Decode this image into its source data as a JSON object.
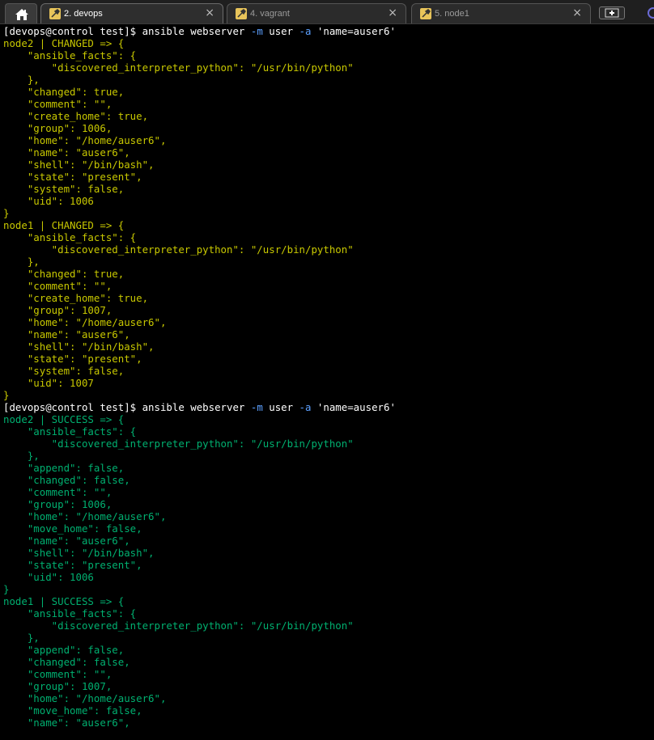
{
  "tabs": [
    {
      "label": "",
      "icon": "home-icon",
      "active": false
    },
    {
      "label": "2. devops",
      "icon": "wrench-icon",
      "active": true,
      "close": "×"
    },
    {
      "label": "4. vagrant",
      "icon": "wrench-icon",
      "active": false,
      "close": "×"
    },
    {
      "label": "5. node1",
      "icon": "wrench-icon",
      "active": false,
      "close": "×"
    }
  ],
  "colors": {
    "background": "#000000",
    "prompt": "#ffffff",
    "option": "#5ca0ff",
    "changed": "#c8c800",
    "success": "#00b070"
  },
  "terminal": {
    "lines": [
      {
        "style": "cmd",
        "prompt": "[devops@control test]$ ",
        "parts": [
          "ansible webserver ",
          "-m",
          " user ",
          "-a",
          " 'name=auser6'"
        ]
      },
      {
        "style": "changed",
        "text": "node2 | CHANGED => {"
      },
      {
        "style": "changed",
        "text": "    \"ansible_facts\": {"
      },
      {
        "style": "changed",
        "text": "        \"discovered_interpreter_python\": \"/usr/bin/python\""
      },
      {
        "style": "changed",
        "text": "    },"
      },
      {
        "style": "changed",
        "text": "    \"changed\": true,"
      },
      {
        "style": "changed",
        "text": "    \"comment\": \"\","
      },
      {
        "style": "changed",
        "text": "    \"create_home\": true,"
      },
      {
        "style": "changed",
        "text": "    \"group\": 1006,"
      },
      {
        "style": "changed",
        "text": "    \"home\": \"/home/auser6\","
      },
      {
        "style": "changed",
        "text": "    \"name\": \"auser6\","
      },
      {
        "style": "changed",
        "text": "    \"shell\": \"/bin/bash\","
      },
      {
        "style": "changed",
        "text": "    \"state\": \"present\","
      },
      {
        "style": "changed",
        "text": "    \"system\": false,"
      },
      {
        "style": "changed",
        "text": "    \"uid\": 1006"
      },
      {
        "style": "changed",
        "text": "}"
      },
      {
        "style": "changed",
        "text": "node1 | CHANGED => {"
      },
      {
        "style": "changed",
        "text": "    \"ansible_facts\": {"
      },
      {
        "style": "changed",
        "text": "        \"discovered_interpreter_python\": \"/usr/bin/python\""
      },
      {
        "style": "changed",
        "text": "    },"
      },
      {
        "style": "changed",
        "text": "    \"changed\": true,"
      },
      {
        "style": "changed",
        "text": "    \"comment\": \"\","
      },
      {
        "style": "changed",
        "text": "    \"create_home\": true,"
      },
      {
        "style": "changed",
        "text": "    \"group\": 1007,"
      },
      {
        "style": "changed",
        "text": "    \"home\": \"/home/auser6\","
      },
      {
        "style": "changed",
        "text": "    \"name\": \"auser6\","
      },
      {
        "style": "changed",
        "text": "    \"shell\": \"/bin/bash\","
      },
      {
        "style": "changed",
        "text": "    \"state\": \"present\","
      },
      {
        "style": "changed",
        "text": "    \"system\": false,"
      },
      {
        "style": "changed",
        "text": "    \"uid\": 1007"
      },
      {
        "style": "changed",
        "text": "}"
      },
      {
        "style": "cmd",
        "prompt": "[devops@control test]$ ",
        "parts": [
          "ansible webserver ",
          "-m",
          " user ",
          "-a",
          " 'name=auser6'"
        ]
      },
      {
        "style": "success",
        "text": "node2 | SUCCESS => {"
      },
      {
        "style": "success",
        "text": "    \"ansible_facts\": {"
      },
      {
        "style": "success",
        "text": "        \"discovered_interpreter_python\": \"/usr/bin/python\""
      },
      {
        "style": "success",
        "text": "    },"
      },
      {
        "style": "success",
        "text": "    \"append\": false,"
      },
      {
        "style": "success",
        "text": "    \"changed\": false,"
      },
      {
        "style": "success",
        "text": "    \"comment\": \"\","
      },
      {
        "style": "success",
        "text": "    \"group\": 1006,"
      },
      {
        "style": "success",
        "text": "    \"home\": \"/home/auser6\","
      },
      {
        "style": "success",
        "text": "    \"move_home\": false,"
      },
      {
        "style": "success",
        "text": "    \"name\": \"auser6\","
      },
      {
        "style": "success",
        "text": "    \"shell\": \"/bin/bash\","
      },
      {
        "style": "success",
        "text": "    \"state\": \"present\","
      },
      {
        "style": "success",
        "text": "    \"uid\": 1006"
      },
      {
        "style": "success",
        "text": "}"
      },
      {
        "style": "success",
        "text": "node1 | SUCCESS => {"
      },
      {
        "style": "success",
        "text": "    \"ansible_facts\": {"
      },
      {
        "style": "success",
        "text": "        \"discovered_interpreter_python\": \"/usr/bin/python\""
      },
      {
        "style": "success",
        "text": "    },"
      },
      {
        "style": "success",
        "text": "    \"append\": false,"
      },
      {
        "style": "success",
        "text": "    \"changed\": false,"
      },
      {
        "style": "success",
        "text": "    \"comment\": \"\","
      },
      {
        "style": "success",
        "text": "    \"group\": 1007,"
      },
      {
        "style": "success",
        "text": "    \"home\": \"/home/auser6\","
      },
      {
        "style": "success",
        "text": "    \"move_home\": false,"
      },
      {
        "style": "success",
        "text": "    \"name\": \"auser6\","
      }
    ]
  }
}
